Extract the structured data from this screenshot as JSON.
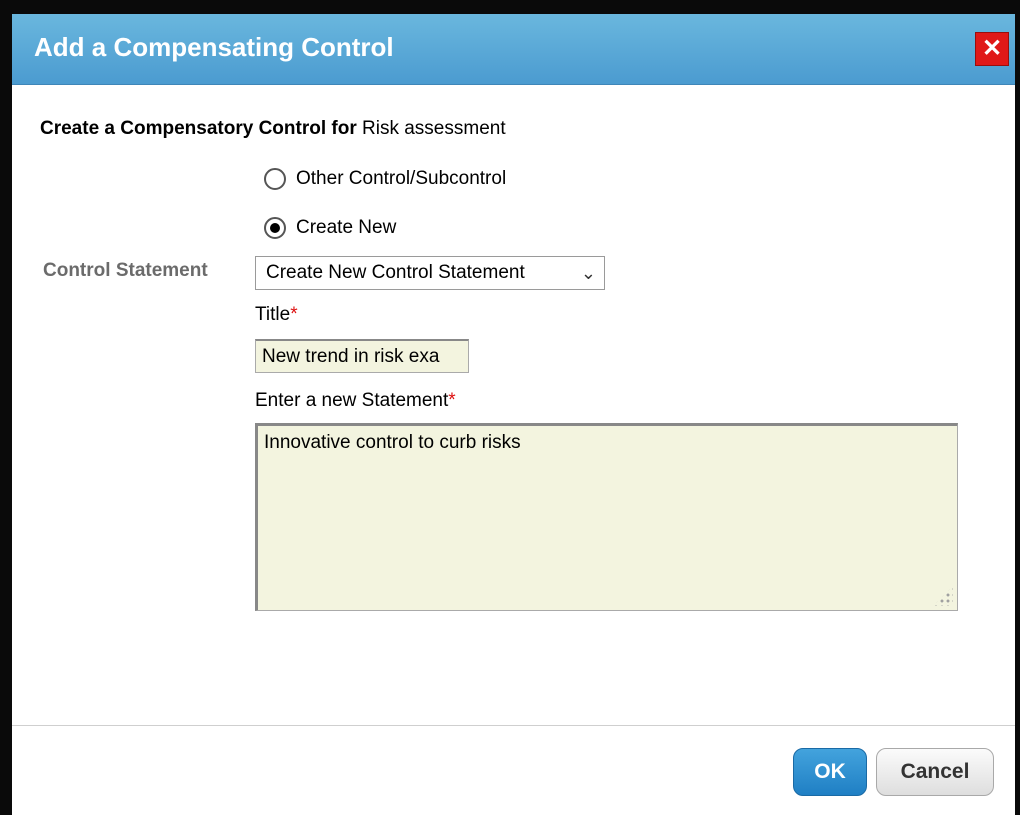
{
  "dialog": {
    "title": "Add a Compensating Control",
    "close_icon": "close-icon",
    "close_glyph": "✕"
  },
  "form": {
    "heading_bold": "Create a Compensatory Control for",
    "heading_target": "Risk assessment",
    "radio_options": [
      {
        "label": "Other Control/Subcontrol",
        "selected": false
      },
      {
        "label": "Create New",
        "selected": true
      }
    ],
    "control_statement_label": "Control Statement",
    "control_statement_select": "Create New Control Statement",
    "title_label": "Title",
    "title_value": "New trend in risk exa",
    "statement_label": "Enter a new Statement",
    "statement_value": "Innovative control to curb risks",
    "required_marker": "*"
  },
  "footer": {
    "ok_label": "OK",
    "cancel_label": "Cancel"
  },
  "colors": {
    "titlebar": "#4b9bd0",
    "close_button": "#e01818",
    "ok_button": "#1f7fc4",
    "input_background": "#f3f4df",
    "required": "#dd1111"
  }
}
